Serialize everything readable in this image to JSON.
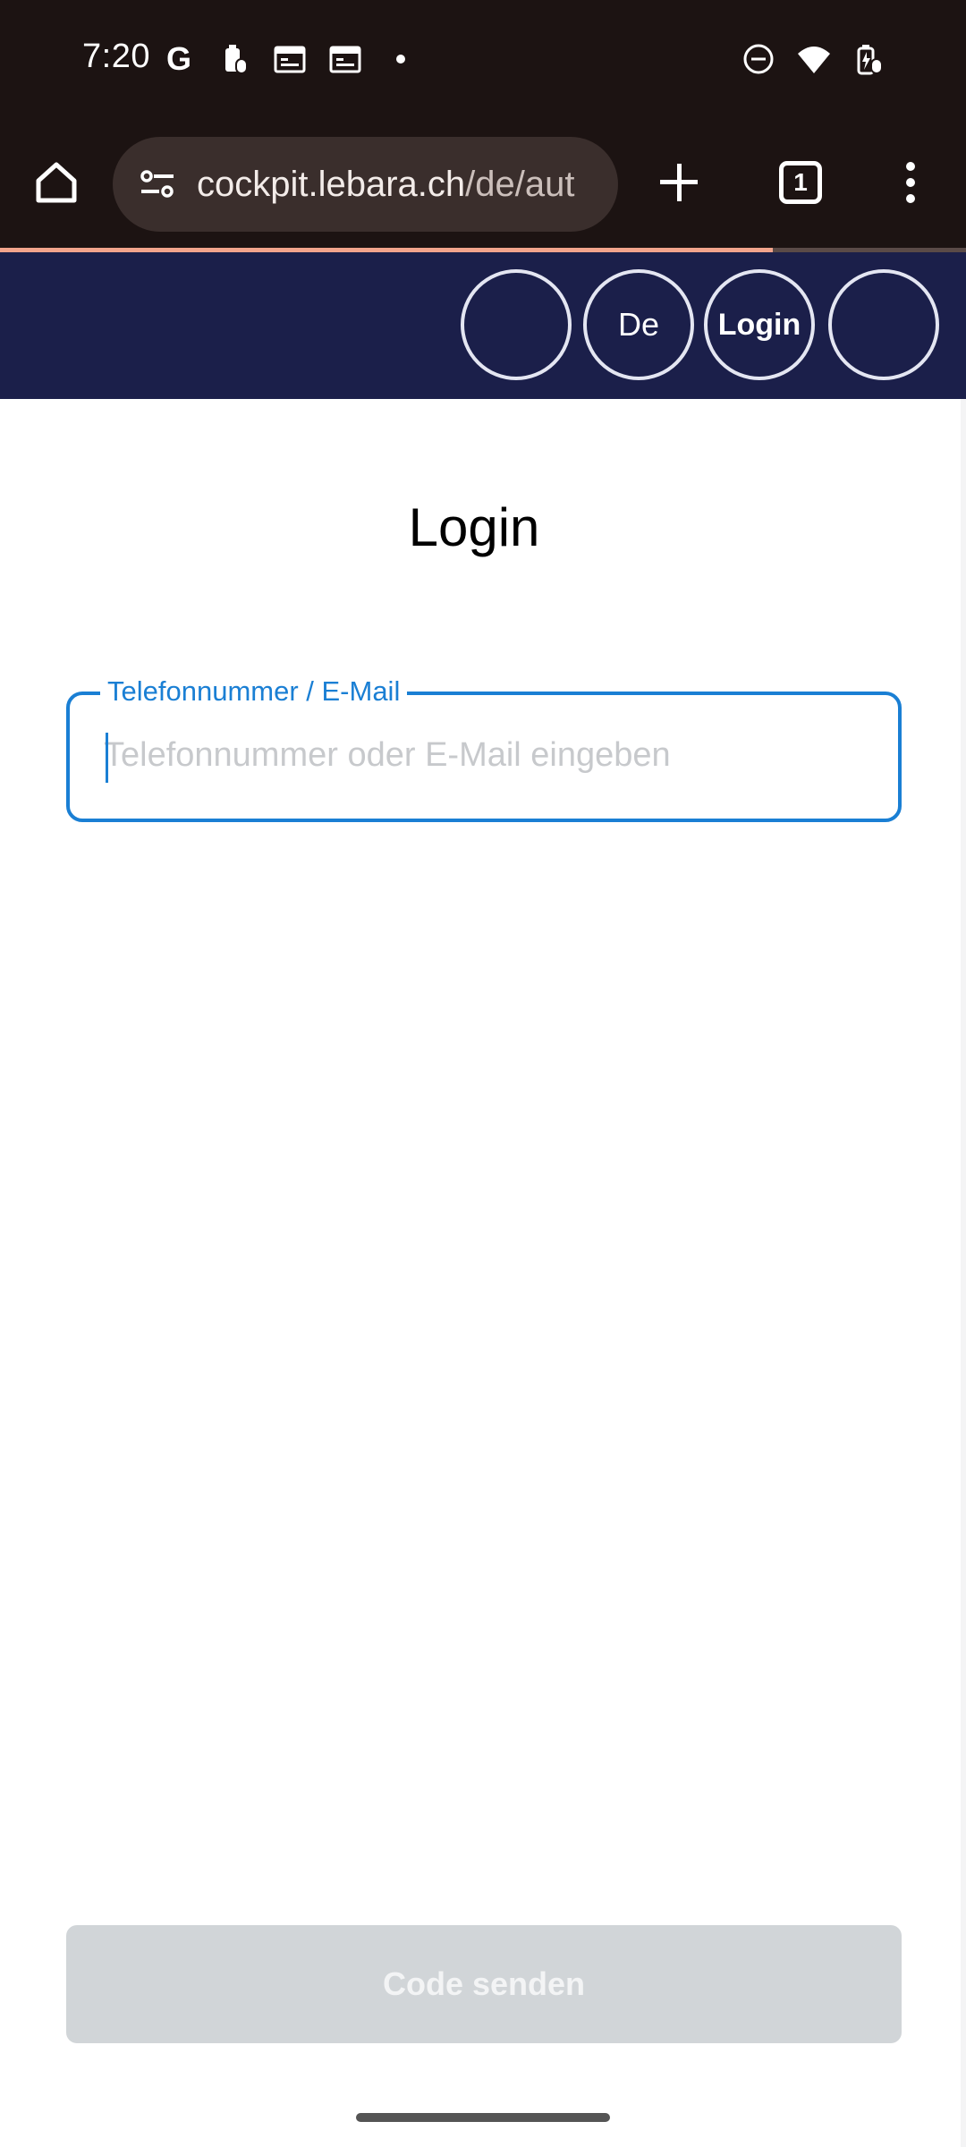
{
  "status_bar": {
    "time": "7:20",
    "left_icons": [
      "google-g-icon",
      "battery-saver-icon",
      "calendar-icon",
      "calendar-icon",
      "dot-icon"
    ],
    "right_icons": [
      "do-not-disturb-icon",
      "wifi-icon",
      "battery-charging-icon"
    ]
  },
  "browser": {
    "url_host": "cockpit.lebara.ch",
    "url_path": "/de/aut",
    "tab_count": "1",
    "load_progress": 0.8
  },
  "site_header": {
    "language_label": "De",
    "login_label": "Login"
  },
  "main": {
    "title": "Login",
    "identifier_field": {
      "label": "Telefonnummer / E-Mail",
      "placeholder": "Telefonnummer oder E-Mail eingeben",
      "value": ""
    },
    "submit_label": "Code senden"
  },
  "colors": {
    "system_bar": "#1c1312",
    "site_header": "#1b1f4a",
    "focus_accent": "#1a7fd4",
    "disabled_button": "#d1d5d8",
    "progress": "#f2a48c"
  }
}
